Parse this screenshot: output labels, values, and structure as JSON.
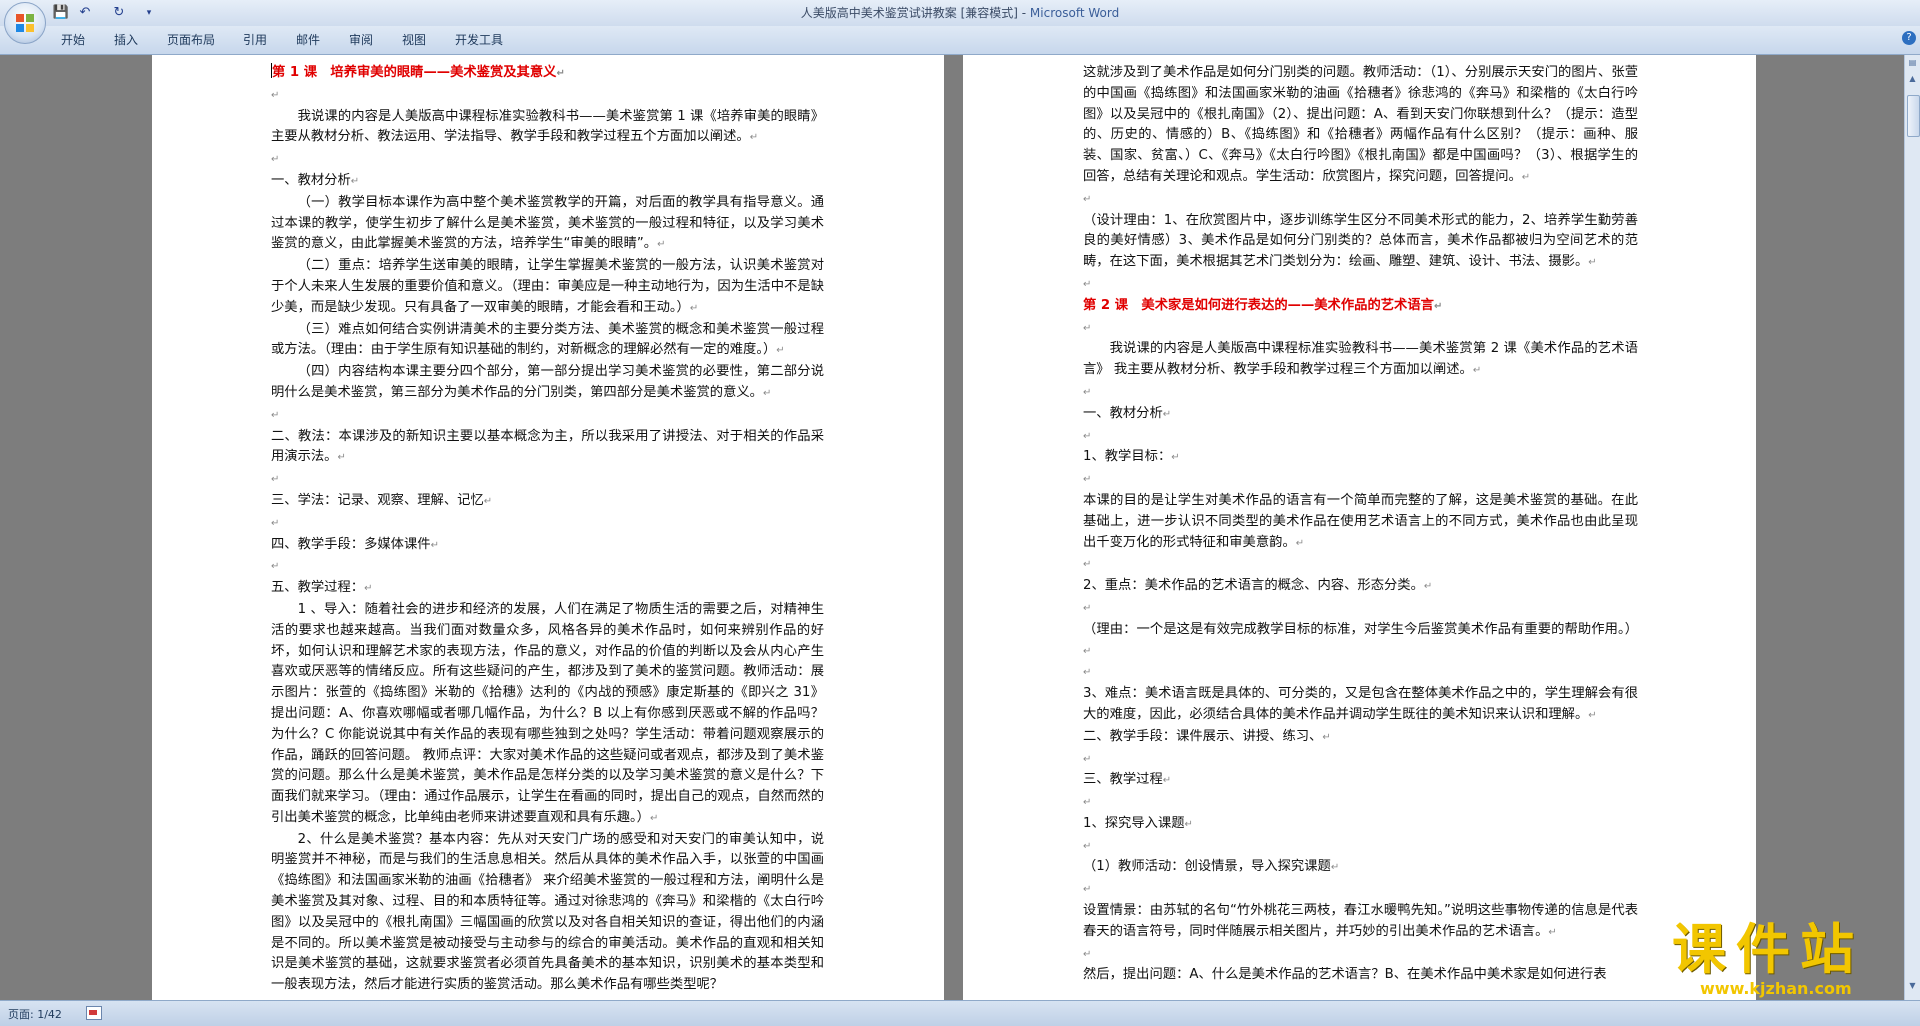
{
  "window": {
    "doc_title": "人美版高中美术鉴赏试讲教案 [兼容模式] - ",
    "app_name": "Microsoft Word"
  },
  "ribbon": {
    "tabs": [
      "开始",
      "插入",
      "页面布局",
      "引用",
      "邮件",
      "审阅",
      "视图",
      "开发工具"
    ]
  },
  "page1": {
    "title": "第 1 课　培养审美的眼睛——美术鉴赏及其意义",
    "paras": [
      "我说课的内容是人美版高中课程标准实验教科书——美术鉴赏第 1 课《培养审美的眼睛》主要从教材分析、教法运用、学法指导、教学手段和教学过程五个方面加以阐述。",
      "一、教材分析",
      "（一）教学目标本课作为高中整个美术鉴赏教学的开篇，对后面的教学具有指导意义。通过本课的教学，使学生初步了解什么是美术鉴赏，美术鉴赏的一般过程和特征，以及学习美术鉴赏的意义，由此掌握美术鉴赏的方法，培养学生“审美的眼睛”。",
      "（二）重点：培养学生送审美的眼睛，让学生掌握美术鉴赏的一般方法，认识美术鉴赏对于个人未来人生发展的重要价值和意义。（理由：审美应是一种主动地行为，因为生活中不是缺少美，而是缺少发现。只有具备了一双审美的眼睛，才能会看和王动。）",
      "（三）难点如何结合实例讲清美术的主要分类方法、美术鉴赏的概念和美术鉴赏一般过程或方法。（理由：由于学生原有知识基础的制约，对新概念的理解必然有一定的难度。）",
      "（四）内容结构本课主要分四个部分，第一部分提出学习美术鉴赏的必要性，第二部分说明什么是美术鉴赏，第三部分为美术作品的分门别类，第四部分是美术鉴赏的意义。",
      "二、教法：本课涉及的新知识主要以基本概念为主，所以我采用了讲授法、对于相关的作品采用演示法。",
      "三、学法：记录、观察、理解、记忆",
      "四、教学手段：多媒体课件",
      "五、教学过程：",
      "1 、导入：随着社会的进步和经济的发展，人们在满足了物质生活的需要之后，对精神生活的要求也越来越高。当我们面对数量众多，风格各异的美术作品时，如何来辨别作品的好坏，如何认识和理解艺术家的表现方法，作品的意义，对作品的价值的判断以及会从内心产生喜欢或厌恶等的情绪反应。所有这些疑问的产生，都涉及到了美术的鉴赏问题。教师活动：展示图片：张萱的《捣练图》米勒的《拾穗》达利的《内战的预感》康定斯基的《即兴之 31》提出问题：A、你喜欢哪幅或者哪几幅作品，为什么？B 以上有你感到厌恶或不解的作品吗？为什么？C 你能说说其中有关作品的表现有哪些独到之处吗？学生活动：带着问题观察展示的作品，踊跃的回答问题。 教师点评：大家对美术作品的这些疑问或者观点，都涉及到了美术鉴赏的问题。那么什么是美术鉴赏，美术作品是怎样分类的以及学习美术鉴赏的意义是什么？下面我们就来学习。（理由：通过作品展示，让学生在看画的同时，提出自己的观点，自然而然的引出美术鉴赏的概念，比单纯由老师来讲述要直观和具有乐趣。）",
      "2、什么是美术鉴赏？基本内容：先从对天安门广场的感受和对天安门的审美认知中，说明鉴赏并不神秘，而是与我们的生活息息相关。然后从具体的美术作品入手，以张萱的中国画《捣练图》和法国画家米勒的油画《拾穗者》 来介绍美术鉴赏的一般过程和方法，阐明什么是美术鉴赏及其对象、过程、目的和本质特征等。通过对徐悲鸿的《奔马》和梁楷的《太白行吟图》以及吴冠中的《根扎南国》三幅国画的欣赏以及对各自相关知识的查证，得出他们的内涵是不同的。所以美术鉴赏是被动接受与主动参与的综合的审美活动。美术作品的直观和相关知识是美术鉴赏的基础，这就要求鉴赏者必须首先具备美术的基本知识，识别美术的基本类型和一般表现方法，然后才能进行实质的鉴赏活动。那么美术作品有哪些类型呢？"
    ]
  },
  "page2": {
    "paras": [
      "这就涉及到了美术作品是如何分门别类的问题。教师活动：（1）、分别展示天安门的图片、张萱的中国画《捣练图》和法国画家米勒的油画《拾穗者》徐悲鸿的《奔马》和梁楷的《太白行吟图》以及吴冠中的《根扎南国》（2）、提出问题：A、看到天安门你联想到什么？（提示：造型的、历史的、情感的）B、《捣练图》和《拾穗者》两幅作品有什么区别？（提示：画种、服装、国家、贫富、）C、《奔马》《太白行吟图》《根扎南国》都是中国画吗？（3）、根据学生的回答，总结有关理论和观点。学生活动：欣赏图片，探究问题，回答提问。",
      "（设计理由：1、在欣赏图片中，逐步训练学生区分不同美术形式的能力，2、培养学生勤劳善良的美好情感）3、美术作品是如何分门别类的？总体而言，美术作品都被归为空间艺术的范畴，在这下面，美术根据其艺术门类划分为：绘画、雕塑、建筑、设计、书法、摄影。"
    ],
    "title": "第 2 课　美术家是如何进行表达的——美术作品的艺术语言",
    "paras2": [
      "我说课的内容是人美版高中课程标准实验教科书——美术鉴赏第 2 课《美术作品的艺术语言》 我主要从教材分析、教学手段和教学过程三个方面加以阐述。",
      "一、教材分析",
      "1、教学目标：",
      "本课的目的是让学生对美术作品的语言有一个简单而完整的了解，这是美术鉴赏的基础。在此基础上，进一步认识不同类型的美术作品在使用艺术语言上的不同方式，美术作品也由此呈现出千变万化的形式特征和审美意韵。",
      "2、重点：美术作品的艺术语言的概念、内容、形态分类。",
      "（理由：一个是这是有效完成教学目标的标准，对学生今后鉴赏美术作品有重要的帮助作用。）",
      "3、难点：美术语言既是具体的、可分类的，又是包含在整体美术作品之中的，学生理解会有很大的难度，因此，必须结合具体的美术作品并调动学生既往的美术知识来认识和理解。",
      "二、教学手段：课件展示、讲授、练习、",
      "三、教学过程",
      "1、探究导入课题",
      "（1）教师活动：创设情景，导入探究课题",
      "设置情景：由苏轼的名句“竹外桃花三两枝，春江水暖鸭先知。”说明这些事物传递的信息是代表春天的语言符号，同时伴随展示相关图片，并巧妙的引出美术作品的艺术语言。",
      "然后，提出问题：A、什么是美术作品的艺术语言？B、在美术作品中美术家是如何进行表"
    ]
  },
  "status": {
    "page": "页面: 1/42"
  },
  "watermark": {
    "big": "课件站",
    "url": "www.kjzhan.com"
  }
}
